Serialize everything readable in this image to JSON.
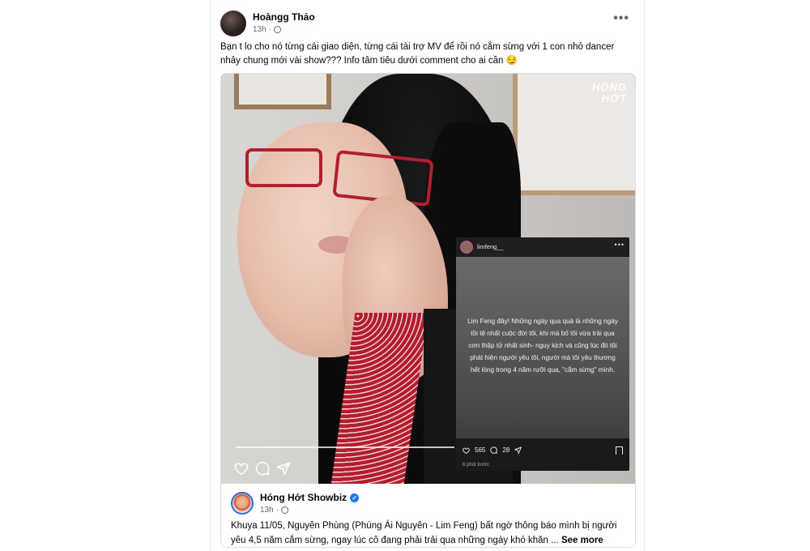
{
  "post": {
    "author": "Hoàngg Thảo",
    "time": "13h",
    "caption": "Bạn t lo cho nó từng cái giao diện, từng cái tài trợ MV để rồi nó cắm sừng với 1 con nhỏ dancer nhảy chung mới vài show??? Info tâm tiêu dưới comment cho ai cần 😏",
    "more_label": "•••"
  },
  "media": {
    "watermark_line1": "HÓNG",
    "watermark_line2": "HỚT",
    "story": {
      "username": "limfeng__",
      "more": "•••",
      "text": "Lim Feng đây! Những ngày qua quả là những ngày tồi tệ nhất cuộc đời tôi, khi mà bố tôi vừa trải qua cơn thập tử nhất sinh- nguy kịch và cũng lúc đó tôi phát hiện người yêu tôi, người mà tôi yêu thương hết lòng trong 4 năm rưỡi qua, \"cắm sừng\" mình.",
      "likes": "565",
      "comments": "28",
      "time": "6 phút trước"
    }
  },
  "shared": {
    "page_name": "Hóng Hớt Showbiz",
    "verified": "✓",
    "time": "13h",
    "text": "Khuya 11/05, Nguyên Phùng (Phùng Ái Nguyên - Lim Feng) bất ngờ thông báo mình bị người yêu 4,5 năm cắm sừng, ngay lúc cô đang phải trải qua những ngày khó khăn ...",
    "see_more": "See more"
  }
}
